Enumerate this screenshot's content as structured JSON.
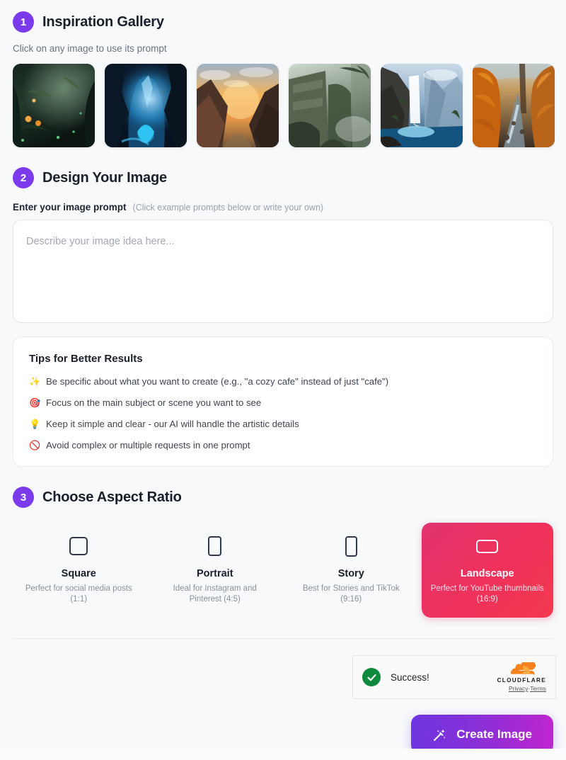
{
  "steps": {
    "one": {
      "number": "1",
      "title": "Inspiration Gallery",
      "hint": "Click on any image to use its prompt"
    },
    "two": {
      "number": "2",
      "title": "Design Your Image"
    },
    "three": {
      "number": "3",
      "title": "Choose Aspect Ratio"
    }
  },
  "gallery": [
    {
      "name": "enchanted-forest",
      "alt": "Glowing enchanted forest with lanterns"
    },
    {
      "name": "crystal-cave",
      "alt": "Blue glowing crystal cave"
    },
    {
      "name": "sunset-mountains",
      "alt": "Golden sunset over mountain valley"
    },
    {
      "name": "overgrown-ruins",
      "alt": "Mossy ancient ruins in mist"
    },
    {
      "name": "waterfall-lake",
      "alt": "Waterfall into turquoise mountain lake"
    },
    {
      "name": "autumn-river",
      "alt": "Autumn forest river with orange trees"
    }
  ],
  "prompt": {
    "label": "Enter your image prompt",
    "hint": "(Click example prompts below or write your own)",
    "placeholder": "Describe your image idea here...",
    "value": ""
  },
  "tips": {
    "title": "Tips for Better Results",
    "items": [
      {
        "emoji": "✨",
        "icon": "sparkles-icon",
        "text": "Be specific about what you want to create (e.g., \"a cozy cafe\" instead of just \"cafe\")"
      },
      {
        "emoji": "🎯",
        "icon": "target-icon",
        "text": "Focus on the main subject or scene you want to see"
      },
      {
        "emoji": "💡",
        "icon": "lightbulb-icon",
        "text": "Keep it simple and clear - our AI will handle the artistic details"
      },
      {
        "emoji": "🚫",
        "icon": "prohibited-icon",
        "text": "Avoid complex or multiple requests in one prompt"
      }
    ]
  },
  "ratios": [
    {
      "name": "Square",
      "desc": "Perfect for social media posts (1:1)",
      "icon": "square-icon",
      "selected": false
    },
    {
      "name": "Portrait",
      "desc": "Ideal for Instagram and Pinterest (4:5)",
      "icon": "portrait-icon",
      "selected": false
    },
    {
      "name": "Story",
      "desc": "Best for Stories and TikTok (9:16)",
      "icon": "story-icon",
      "selected": false
    },
    {
      "name": "Landscape",
      "desc": "Perfect for YouTube thumbnails (16:9)",
      "icon": "landscape-icon",
      "selected": true
    }
  ],
  "turnstile": {
    "status": "Success!",
    "brand": "CLOUDFLARE",
    "privacy": "Privacy",
    "separator": "·",
    "terms": "Terms"
  },
  "submit": {
    "label": "Create Image",
    "icon": "magic-wand-icon"
  },
  "colors": {
    "accent_purple": "#7c3aed",
    "selected_pink": "#f0315b",
    "success_green": "#0c8a3e",
    "cloudflare_orange": "#f6821f",
    "page_bg": "#f7f9fb"
  }
}
